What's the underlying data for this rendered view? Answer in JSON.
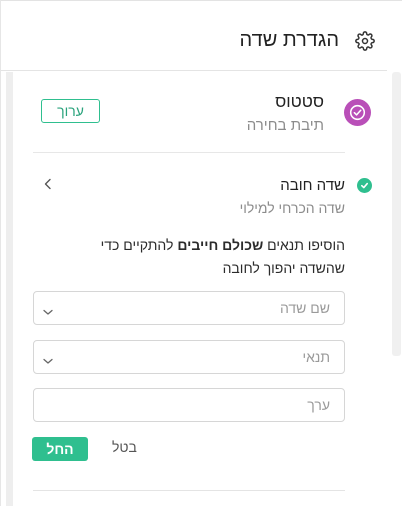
{
  "header": {
    "title": "הגדרת שדה",
    "icon": "gear-icon"
  },
  "status": {
    "title": "סטטוס",
    "subtitle": "תיבת בחירה",
    "icon": "check-circle-icon",
    "icon_color": "#b94fb8",
    "edit_label": "ערוך"
  },
  "required": {
    "title": "שדה חובה",
    "subtitle": "שדה הכרחי למילוי",
    "icon": "check-icon",
    "icon_color": "#2fbf8f"
  },
  "instructions": {
    "part1": "הוסיפו תנאים ",
    "bold": "שכולם חייבים",
    "part2": " להתקיים כדי שהשדה יהפוך לחובה"
  },
  "form": {
    "field_select_placeholder": "שם שדה",
    "condition_select_placeholder": "תנאי",
    "value_placeholder": "ערך",
    "apply_label": "החל",
    "cancel_label": "בטל"
  },
  "colors": {
    "accent": "#2fbf8f",
    "status_purple": "#b94fb8"
  }
}
